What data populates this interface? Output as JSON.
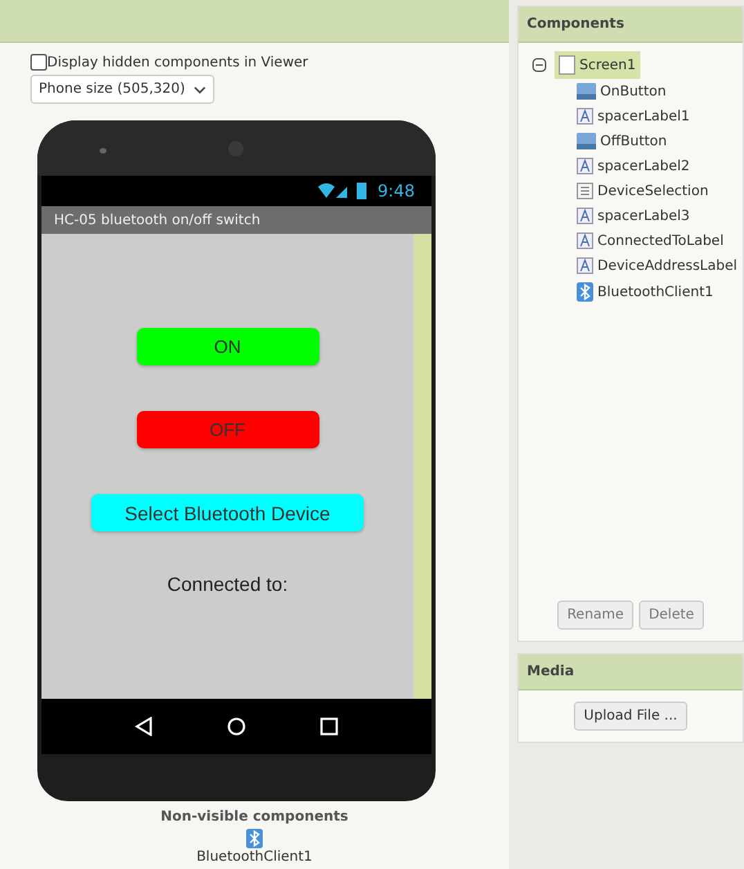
{
  "viewer": {
    "hidden_checkbox": {
      "label": "Display hidden components in Viewer",
      "checked": false
    },
    "size_select": {
      "value": "Phone size (505,320)"
    },
    "phone": {
      "status_time": "9:48",
      "title": "HC-05 bluetooth on/off switch",
      "widgets": [
        {
          "kind": "button",
          "text": "ON",
          "color": "#00ff00",
          "wide": false
        },
        {
          "kind": "button",
          "text": "OFF",
          "color": "#ff0000",
          "wide": false
        },
        {
          "kind": "button",
          "text": "Select Bluetooth Device",
          "color": "#00ffff",
          "wide": true
        },
        {
          "kind": "label",
          "text": "Connected to:"
        }
      ]
    },
    "non_visible": {
      "title": "Non-visible components",
      "items": [
        {
          "label": "BluetoothClient1"
        }
      ]
    }
  },
  "components": {
    "title": "Components",
    "tree": {
      "label": "Screen1",
      "kind": "screen",
      "expanded": true,
      "selected": true,
      "children": [
        {
          "label": "OnButton",
          "kind": "button",
          "selected": false
        },
        {
          "label": "spacerLabel1",
          "kind": "label",
          "selected": false
        },
        {
          "label": "OffButton",
          "kind": "button",
          "selected": false
        },
        {
          "label": "spacerLabel2",
          "kind": "label",
          "selected": false
        },
        {
          "label": "DeviceSelection",
          "kind": "listpicker",
          "selected": false
        },
        {
          "label": "spacerLabel3",
          "kind": "label",
          "selected": false
        },
        {
          "label": "ConnectedToLabel",
          "kind": "label",
          "selected": false
        },
        {
          "label": "DeviceAddressLabel",
          "kind": "label",
          "selected": false
        },
        {
          "label": "BluetoothClient1",
          "kind": "bluetooth",
          "selected": false
        }
      ]
    },
    "buttons": [
      "Rename",
      "Delete"
    ]
  },
  "media": {
    "title": "Media",
    "button": "Upload File ..."
  }
}
